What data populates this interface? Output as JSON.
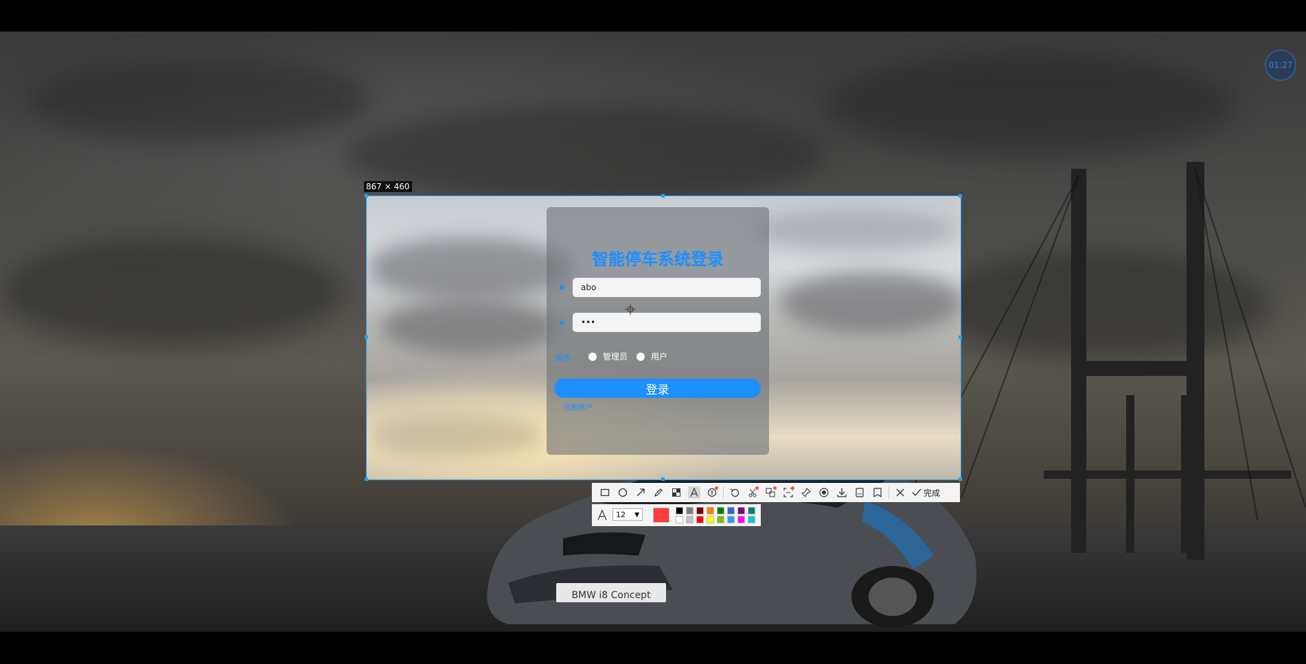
{
  "capture": {
    "size_label": "867 × 460",
    "timer": "01:27"
  },
  "login": {
    "title": "智能停车系统登录",
    "username_value": "abo",
    "password_value": "•••",
    "role_label": "角色",
    "roles": [
      "管理员",
      "用户"
    ],
    "login_button": "登录",
    "register_link": "注册账户"
  },
  "car_badge": "BMW i8 Concept",
  "toolbar": {
    "done_label": "完成",
    "font_size": "12",
    "current_color": "#ff3b3b",
    "palette_top": [
      "#000000",
      "#808080",
      "#800000",
      "#ff8000",
      "#008000",
      "#3366cc",
      "#800080",
      "#008080"
    ],
    "palette_bottom": [
      "#ffffff",
      "#c0c0c0",
      "#ff0000",
      "#ffff00",
      "#80c000",
      "#3399ff",
      "#ff00ff",
      "#00cccc"
    ],
    "tools": [
      "rectangle-icon",
      "ellipse-icon",
      "arrow-icon",
      "pen-icon",
      "mosaic-icon",
      "text-icon",
      "serial-number-icon",
      "undo-icon",
      "scissors-icon",
      "translate-icon",
      "ocr-icon",
      "pin-icon",
      "record-icon",
      "download-icon",
      "save-icon",
      "bookmark-icon",
      "close-icon",
      "check-icon"
    ]
  }
}
